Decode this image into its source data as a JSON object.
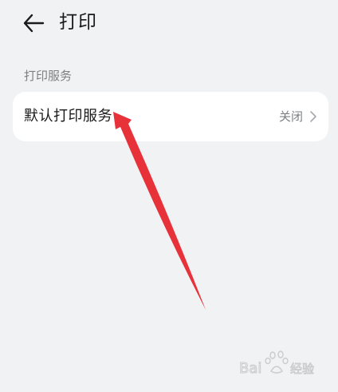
{
  "header": {
    "back_icon": "arrow-left-icon",
    "title": "打印"
  },
  "section": {
    "label": "打印服务"
  },
  "default_service": {
    "label": "默认打印服务",
    "value": "关闭",
    "chevron_icon": "chevron-right-icon"
  },
  "annotation": {
    "arrow_color": "#e8323a"
  },
  "watermark": {
    "text": "Bai 经验"
  },
  "colors": {
    "background": "#f1f2f4",
    "card": "#ffffff",
    "primary_text": "#1a1a1a",
    "secondary_text": "#7d7f82"
  }
}
